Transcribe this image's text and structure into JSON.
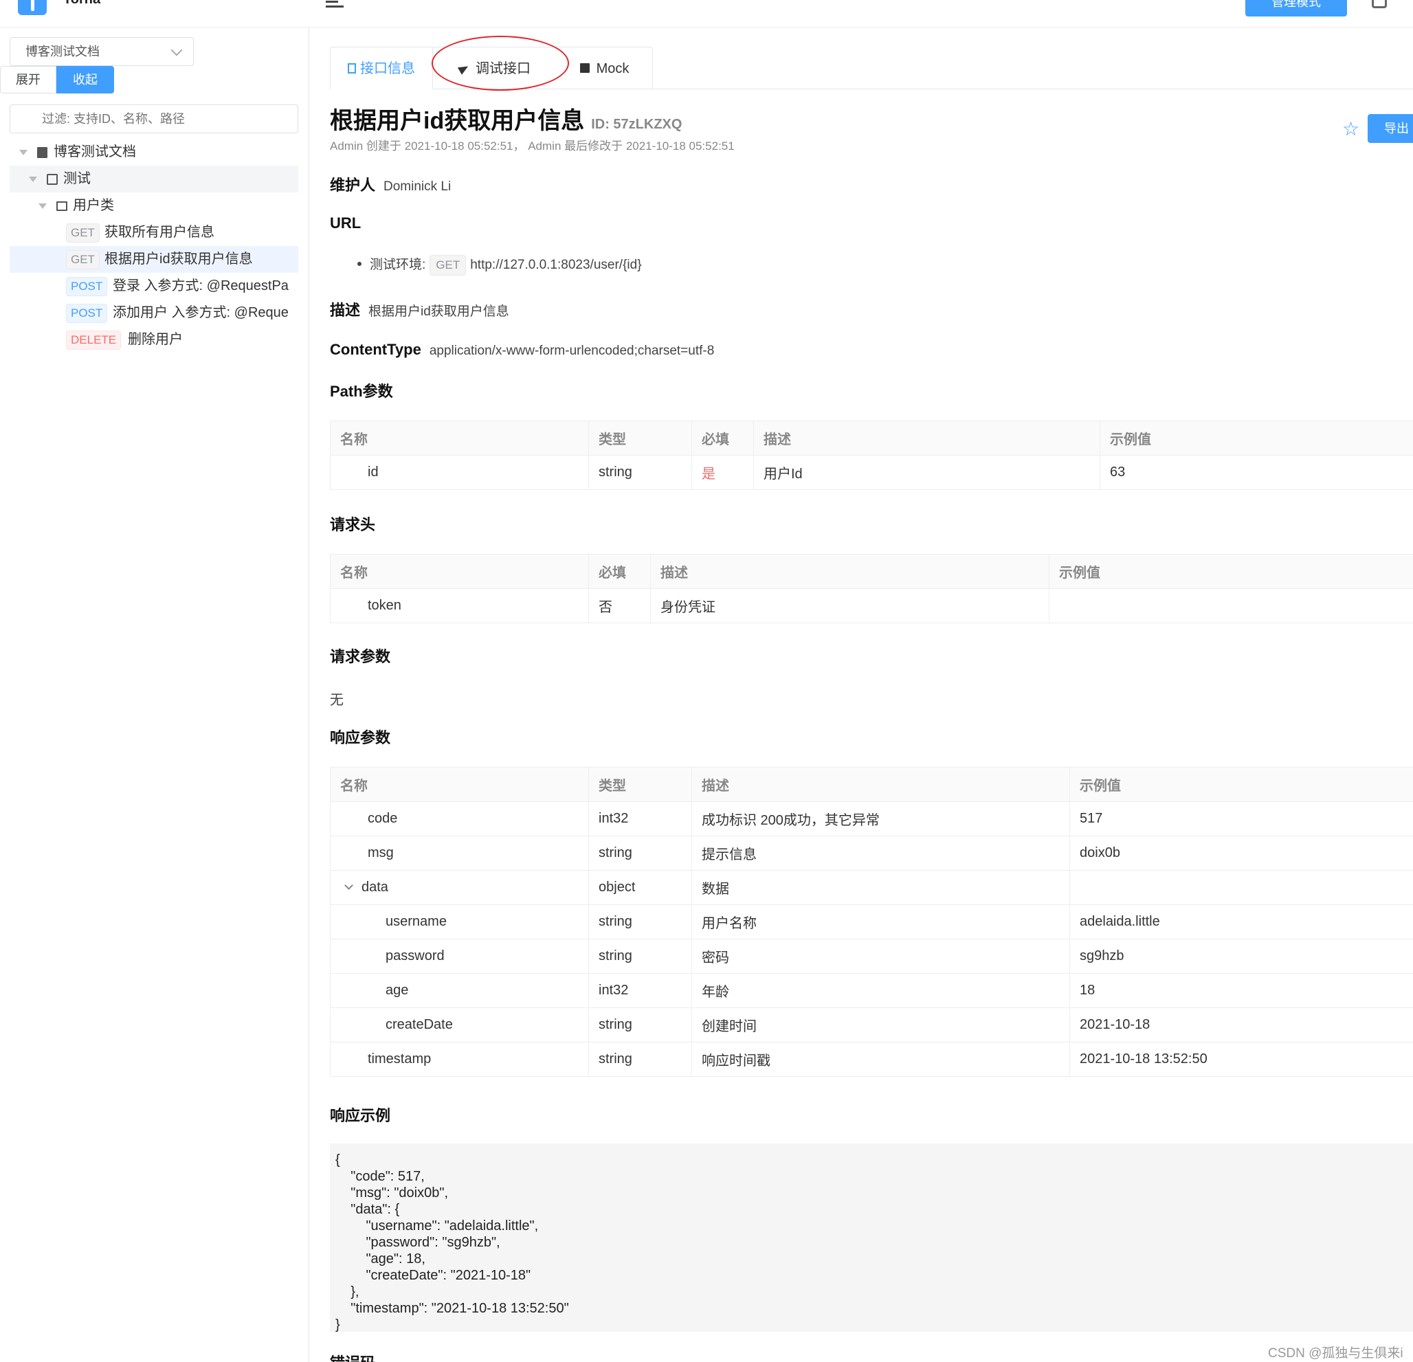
{
  "header": {
    "app_name": "Torna",
    "admin_button": "管理模式"
  },
  "sidebar": {
    "doc_select": "博客测试文档",
    "expand_label": "展开",
    "collapse_label": "收起",
    "filter_placeholder": "过滤: 支持ID、名称、路径",
    "tree": {
      "root": "博客测试文档",
      "module": "测试",
      "folder": "用户类",
      "items": [
        {
          "method": "GET",
          "label": "获取所有用户信息"
        },
        {
          "method": "GET",
          "label": "根据用户id获取用户信息"
        },
        {
          "method": "POST",
          "label": "登录 入参方式: @RequestPa"
        },
        {
          "method": "POST",
          "label": "添加用户 入参方式: @Reque"
        },
        {
          "method": "DELETE",
          "label": "删除用户"
        }
      ]
    }
  },
  "tabs": {
    "info": "接口信息",
    "debug": "调试接口",
    "mock": "Mock"
  },
  "doc": {
    "title": "根据用户id获取用户信息",
    "id_text": "ID: 57zLKZXQ",
    "meta": "Admin 创建于 2021-10-18 05:52:51， Admin 最后修改于 2021-10-18 05:52:51",
    "export_label": "导出",
    "maintainer_label": "维护人",
    "maintainer": "Dominick Li",
    "url_label": "URL",
    "env_label": "测试环境:",
    "env_method": "GET",
    "env_url": "http://127.0.0.1:8023/user/{id}",
    "desc_label": "描述",
    "desc": "根据用户id获取用户信息",
    "content_type_label": "ContentType",
    "content_type": "application/x-www-form-urlencoded;charset=utf-8",
    "path_params_label": "Path参数",
    "headers_label": "请求头",
    "request_params_label": "请求参数",
    "request_params_none": "无",
    "response_params_label": "响应参数",
    "response_example_label": "响应示例",
    "error_code_label": "错误码"
  },
  "path_table": {
    "headers": [
      "名称",
      "类型",
      "必填",
      "描述",
      "示例值"
    ],
    "rows": [
      [
        "id",
        "string",
        "是",
        "用户Id",
        "63"
      ]
    ]
  },
  "header_table": {
    "headers": [
      "名称",
      "必填",
      "描述",
      "示例值"
    ],
    "rows": [
      [
        "token",
        "否",
        "身份凭证",
        ""
      ]
    ]
  },
  "response_table": {
    "headers": [
      "名称",
      "类型",
      "描述",
      "示例值"
    ],
    "rows": [
      [
        "code",
        "int32",
        "成功标识 200成功，其它异常",
        "517"
      ],
      [
        "msg",
        "string",
        "提示信息",
        "doix0b"
      ],
      [
        "data",
        "object",
        "数据",
        ""
      ],
      [
        "username",
        "string",
        "用户名称",
        "adelaida.little"
      ],
      [
        "password",
        "string",
        "密码",
        "sg9hzb"
      ],
      [
        "age",
        "int32",
        "年龄",
        "18"
      ],
      [
        "createDate",
        "string",
        "创建时间",
        "2021-10-18"
      ],
      [
        "timestamp",
        "string",
        "响应时间戳",
        "2021-10-18 13:52:50"
      ]
    ]
  },
  "response_example": "{\n    \"code\": 517,\n    \"msg\": \"doix0b\",\n    \"data\": {\n        \"username\": \"adelaida.little\",\n        \"password\": \"sg9hzb\",\n        \"age\": 18,\n        \"createDate\": \"2021-10-18\"\n    },\n    \"timestamp\": \"2021-10-18 13:52:50\"\n}",
  "watermark": "CSDN @孤独与生俱来i",
  "colors": {
    "primary": "#409eff",
    "required": "#f56c6c",
    "annotation_circle": "#e0242b"
  }
}
